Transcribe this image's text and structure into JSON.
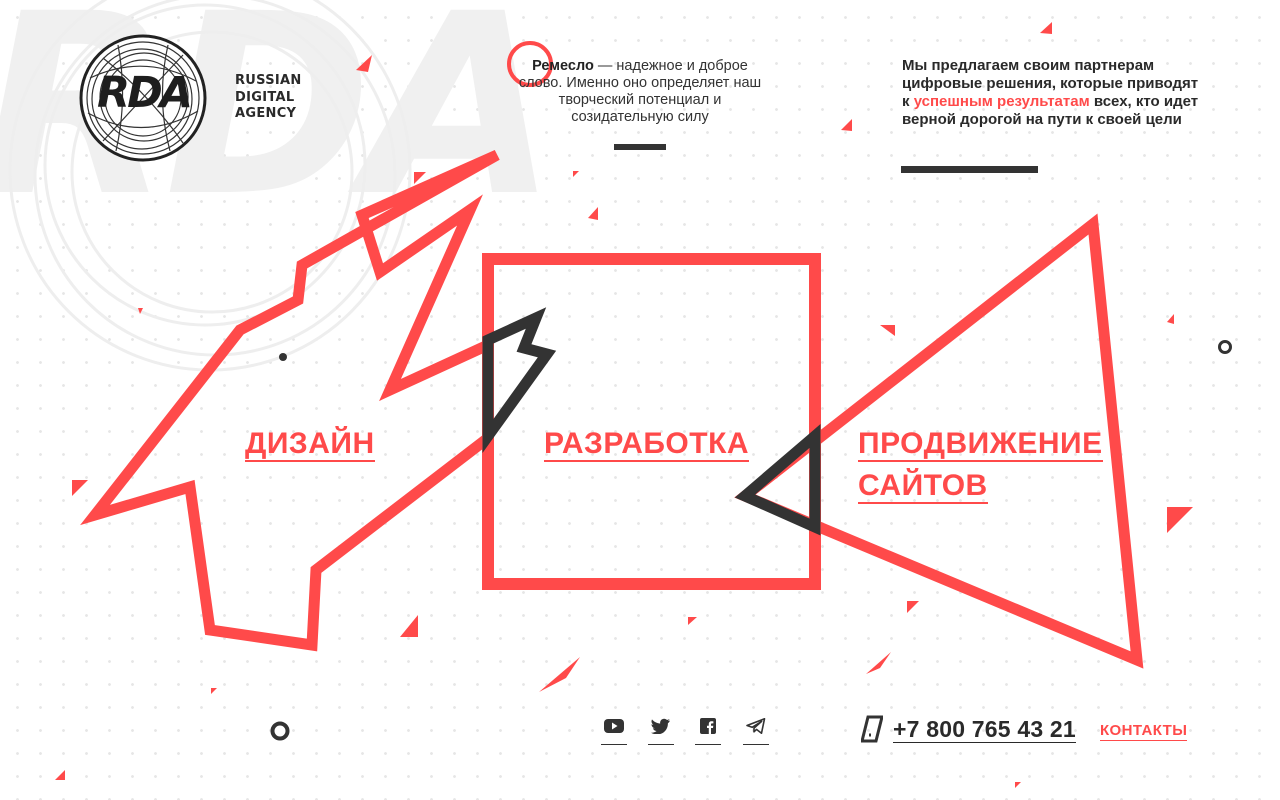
{
  "brand": {
    "logo_text": "RDA",
    "watermark_text": "RDA",
    "agency_lines": [
      "RUSSIAN",
      "DIGITAL",
      "AGENCY"
    ]
  },
  "motto": {
    "bold": "Ремесло",
    "rest": " — надежное и доброе слово. Именно оно определяет наш творческий потенциал и созидательную силу"
  },
  "offer": {
    "before": "Мы предлагаем своим партнерам цифровые решения, которые приводят к ",
    "highlight": "успешным результатам",
    "after": " всех, кто идет верной дорогой на пути к своей цели"
  },
  "services": {
    "design": "ДИЗАЙН",
    "development": "РАЗРАБОТКА",
    "promotion_line1": "ПРОДВИЖЕНИЕ",
    "promotion_line2": "САЙТОВ"
  },
  "social": [
    {
      "icon": "youtube-icon"
    },
    {
      "icon": "twitter-icon"
    },
    {
      "icon": "facebook-icon"
    },
    {
      "icon": "telegram-icon"
    }
  ],
  "footer": {
    "phone": "+7 800 765 43 21",
    "contacts": "КОНТАКТЫ"
  },
  "colors": {
    "accent": "#ff4a4a",
    "dark": "#333333",
    "background": "#ffffff"
  }
}
